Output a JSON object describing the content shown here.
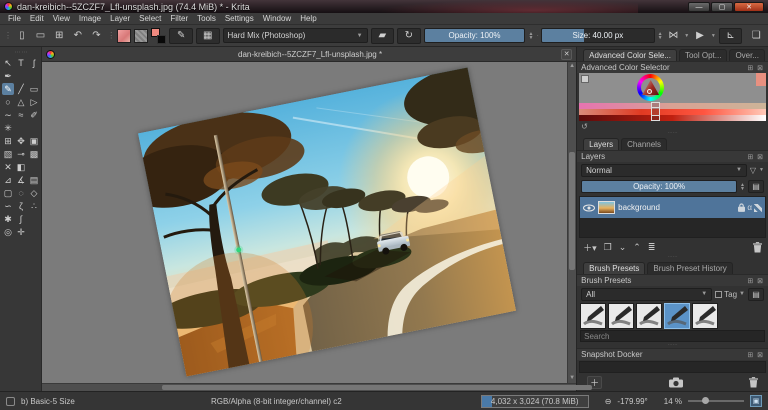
{
  "window": {
    "title": "dan-kreibich--5ZCZF7_Lfl-unsplash.jpg (74.4 MiB) * - Krita",
    "minimize_label": "—",
    "maximize_label": "▢",
    "close_label": "✕"
  },
  "menu": {
    "items": [
      "File",
      "Edit",
      "View",
      "Image",
      "Layer",
      "Select",
      "Filter",
      "Tools",
      "Settings",
      "Window",
      "Help"
    ]
  },
  "toolbar": {
    "blend_mode": "Hard Mix (Photoshop)",
    "opacity_label": "Opacity: 100%",
    "opacity_fill_pct": 100,
    "size_label": "Size: 40.00 px",
    "size_fill_pct": 38,
    "icons": {
      "new": "▯",
      "open": "▭",
      "save": "⊞",
      "undo": "↶",
      "redo": "↷",
      "edit-brush": "✎",
      "preset-grid": "▦",
      "eraser": "▰",
      "reload-preset": "↻",
      "mirror": "⋈",
      "flow": "▶",
      "reset-rotation": "⊾",
      "workspace": "❏"
    }
  },
  "document": {
    "tab_title": "dan-kreibich--5ZCZF7_Lfl-unsplash.jpg *",
    "close_label": "✕"
  },
  "toolbox": {
    "selected": "freehand-brush-tool",
    "rows": [
      [
        {
          "name": "select-shapes-tool",
          "glyph": "↖"
        },
        {
          "name": "text-tool",
          "glyph": "T"
        },
        {
          "name": "calligraphy-tool",
          "glyph": "ʃ"
        }
      ],
      [
        {
          "name": "edit-shapes-tool",
          "glyph": "✒"
        }
      ],
      [
        {
          "name": "freehand-brush-tool",
          "glyph": "✎",
          "sel": true
        },
        {
          "name": "line-tool",
          "glyph": "╱"
        },
        {
          "name": "rectangle-tool",
          "glyph": "▭"
        }
      ],
      [
        {
          "name": "ellipse-tool",
          "glyph": "○"
        },
        {
          "name": "polygon-tool",
          "glyph": "△"
        },
        {
          "name": "polyline-tool",
          "glyph": "▷"
        }
      ],
      [
        {
          "name": "bezier-curve-tool",
          "glyph": "∼"
        },
        {
          "name": "freehand-path-tool",
          "glyph": "≈"
        },
        {
          "name": "dynamic-brush-tool",
          "glyph": "✐"
        }
      ],
      [
        {
          "name": "multibrush-tool",
          "glyph": "✳"
        }
      ],
      [
        {
          "name": "transform-tool",
          "glyph": "⊞"
        },
        {
          "name": "move-tool",
          "glyph": "✥"
        },
        {
          "name": "crop-tool",
          "glyph": "▣"
        }
      ],
      [
        {
          "name": "gradient-tool",
          "glyph": "▧"
        },
        {
          "name": "color-sampler-tool",
          "glyph": "⊸"
        },
        {
          "name": "patch-tool",
          "glyph": "▩"
        }
      ],
      [
        {
          "name": "colorize-mask-tool",
          "glyph": "✕"
        },
        {
          "name": "fill-tool",
          "glyph": "◧"
        }
      ],
      [
        {
          "name": "assistants-tool",
          "glyph": "⊿"
        },
        {
          "name": "measure-tool",
          "glyph": "∡"
        },
        {
          "name": "reference-images-tool",
          "glyph": "▤"
        }
      ],
      [
        {
          "name": "rect-select-tool",
          "glyph": "▢"
        },
        {
          "name": "ellipse-select-tool",
          "glyph": "◌"
        },
        {
          "name": "poly-select-tool",
          "glyph": "◇"
        }
      ],
      [
        {
          "name": "freehand-select-tool",
          "glyph": "∽"
        },
        {
          "name": "magnetic-select-tool",
          "glyph": "ζ"
        },
        {
          "name": "similar-select-tool",
          "glyph": "∴"
        }
      ],
      [
        {
          "name": "contiguous-select-tool",
          "glyph": "✱"
        },
        {
          "name": "bezier-select-tool",
          "glyph": "∫"
        }
      ],
      [
        {
          "name": "zoom-tool",
          "glyph": "◎"
        },
        {
          "name": "pan-tool",
          "glyph": "✛"
        }
      ]
    ]
  },
  "docker": {
    "top_tabs": [
      {
        "label": "Advanced Color Sele...",
        "active": true
      },
      {
        "label": "Tool Opt...",
        "active": false
      },
      {
        "label": "Over...",
        "active": false
      }
    ],
    "color_selector": {
      "title": "Advanced Color Selector",
      "swatch_color": "#e89080"
    },
    "layers": {
      "tabs": [
        {
          "label": "Layers",
          "active": true
        },
        {
          "label": "Channels",
          "active": false
        }
      ],
      "title": "Layers",
      "blend_mode": "Normal",
      "opacity_label": "Opacity: 100%",
      "layer_name": "background",
      "alpha_label": "α"
    },
    "brush_presets": {
      "tabs": [
        {
          "label": "Brush Presets",
          "active": true
        },
        {
          "label": "Brush Preset History",
          "active": false
        }
      ],
      "title": "Brush Presets",
      "filter_value": "All",
      "tag_label": "Tag",
      "search_placeholder": "Search",
      "preset_count": 5,
      "selected_index": 3
    },
    "snapshot": {
      "title": "Snapshot Docker"
    }
  },
  "statusbar": {
    "preset_name": "b) Basic-5 Size",
    "colorspace": "RGB/Alpha (8-bit integer/channel)  c2",
    "doc_size": "4,032 x 3,024 (70.8 MiB)",
    "reset_rotation_glyph": "⊖",
    "rotation": "-179.99°",
    "zoom": "14 %"
  },
  "colors": {
    "accent_blue": "#5c80a0",
    "layer_selected": "#4f749a",
    "brush_selected": "#5b93c8",
    "canvas_bg": "#7b7b7b"
  }
}
